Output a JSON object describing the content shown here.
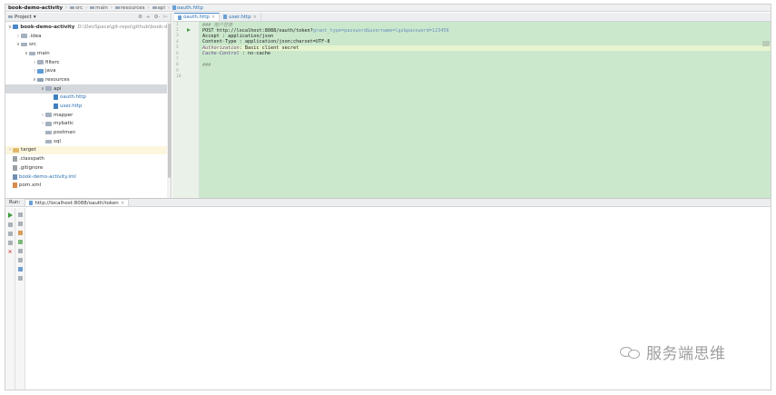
{
  "breadcrumb": [
    {
      "label": "book-demo-activity",
      "kind": "project"
    },
    {
      "label": "src",
      "kind": "folder"
    },
    {
      "label": "main",
      "kind": "folder"
    },
    {
      "label": "resources",
      "kind": "folder"
    },
    {
      "label": "api",
      "kind": "folder"
    },
    {
      "label": "oauth.http",
      "kind": "file"
    }
  ],
  "project_panel": {
    "title": "Project",
    "title_caret": "▾",
    "tools": [
      "⚙",
      "÷",
      "⚙·",
      "⊢"
    ],
    "tree": [
      {
        "depth": 0,
        "arrow": "∨",
        "icon": "module",
        "label": "book-demo-activity",
        "path": "D:\\DevSpace\\git-repo\\github\\book-de",
        "style": "bold"
      },
      {
        "depth": 1,
        "arrow": "›",
        "icon": "folder",
        "label": ".idea"
      },
      {
        "depth": 1,
        "arrow": "∨",
        "icon": "folder",
        "label": "src"
      },
      {
        "depth": 2,
        "arrow": "∨",
        "icon": "folder",
        "label": "main"
      },
      {
        "depth": 3,
        "arrow": "›",
        "icon": "folder",
        "label": "filterc"
      },
      {
        "depth": 3,
        "arrow": "›",
        "icon": "folder-src",
        "label": "java"
      },
      {
        "depth": 3,
        "arrow": "∨",
        "icon": "folder-res",
        "label": "resources"
      },
      {
        "depth": 4,
        "arrow": "∨",
        "icon": "folder",
        "label": "api",
        "state": "selected"
      },
      {
        "depth": 5,
        "arrow": "",
        "icon": "http",
        "label": "oauth.http",
        "style": "blue"
      },
      {
        "depth": 5,
        "arrow": "",
        "icon": "http",
        "label": "user.http",
        "style": "blue"
      },
      {
        "depth": 4,
        "arrow": "›",
        "icon": "folder",
        "label": "mapper"
      },
      {
        "depth": 4,
        "arrow": "›",
        "icon": "folder",
        "label": "mybatic"
      },
      {
        "depth": 4,
        "arrow": "",
        "icon": "folder",
        "label": "postman"
      },
      {
        "depth": 4,
        "arrow": "",
        "icon": "folder",
        "label": "sql"
      },
      {
        "depth": 0,
        "arrow": "›",
        "icon": "folder-target",
        "label": "target",
        "state": "highlight"
      },
      {
        "depth": 0,
        "arrow": "",
        "icon": "file",
        "label": ".classpath"
      },
      {
        "depth": 0,
        "arrow": "",
        "icon": "file",
        "label": ".gitignore"
      },
      {
        "depth": 0,
        "arrow": "",
        "icon": "iml",
        "label": "book-demo-activity.iml",
        "style": "blue"
      },
      {
        "depth": 0,
        "arrow": "",
        "icon": "xml",
        "label": "pom.xml"
      }
    ]
  },
  "editor": {
    "tabs": [
      {
        "label": "oauth.http",
        "close": "×",
        "active": true
      },
      {
        "label": "user.http",
        "close": "×",
        "active": false
      }
    ],
    "line_numbers": [
      "1",
      "2",
      "3",
      "4",
      "5",
      "6",
      "7",
      "8",
      "9",
      "10"
    ],
    "lines": [
      {
        "parts": [
          {
            "t": "### 用户登录",
            "c": "comment"
          }
        ]
      },
      {
        "run": true,
        "parts": [
          {
            "t": "POST http://localhost:8088/oauth/token?",
            "c": "url"
          },
          {
            "t": "grant_type=password&username=lgz&password=123456",
            "c": "param"
          }
        ]
      },
      {
        "parts": [
          {
            "t": "Accept : application/json",
            "c": "url"
          }
        ]
      },
      {
        "parts": [
          {
            "t": "Content-Type : application/json;charset=UTF-8",
            "c": "url"
          }
        ]
      },
      {
        "current": true,
        "parts": [
          {
            "t": "Authorization",
            "c": "key"
          },
          {
            "t": ": Basic client secret",
            "c": "url"
          }
        ]
      },
      {
        "parts": [
          {
            "t": "Cache-Control",
            "c": "key"
          },
          {
            "t": " : no-cache",
            "c": "url"
          }
        ]
      },
      {
        "parts": [
          {
            "t": "",
            "c": "url"
          }
        ]
      },
      {
        "parts": [
          {
            "t": "###",
            "c": "comment"
          }
        ]
      },
      {
        "parts": [
          {
            "t": "",
            "c": "url"
          }
        ]
      },
      {
        "parts": [
          {
            "t": "",
            "c": "url"
          }
        ]
      }
    ],
    "background_color": "#cbe8cc"
  },
  "run_panel": {
    "label": "Run:",
    "tab_label": "http://localhost:8088/oauth/token",
    "tab_close": "×",
    "left_tools": [
      "play",
      "stop",
      "layout",
      "pin",
      "close"
    ],
    "right_tools": [
      "down",
      "up",
      "filter",
      "sort",
      "export",
      "copy",
      "help",
      "trash"
    ]
  },
  "watermark": {
    "text": "服务端思维"
  },
  "colors": {
    "accent": "#4a86c8",
    "editor_bg": "#cbe8cc",
    "run_green": "#3f9a3f"
  }
}
